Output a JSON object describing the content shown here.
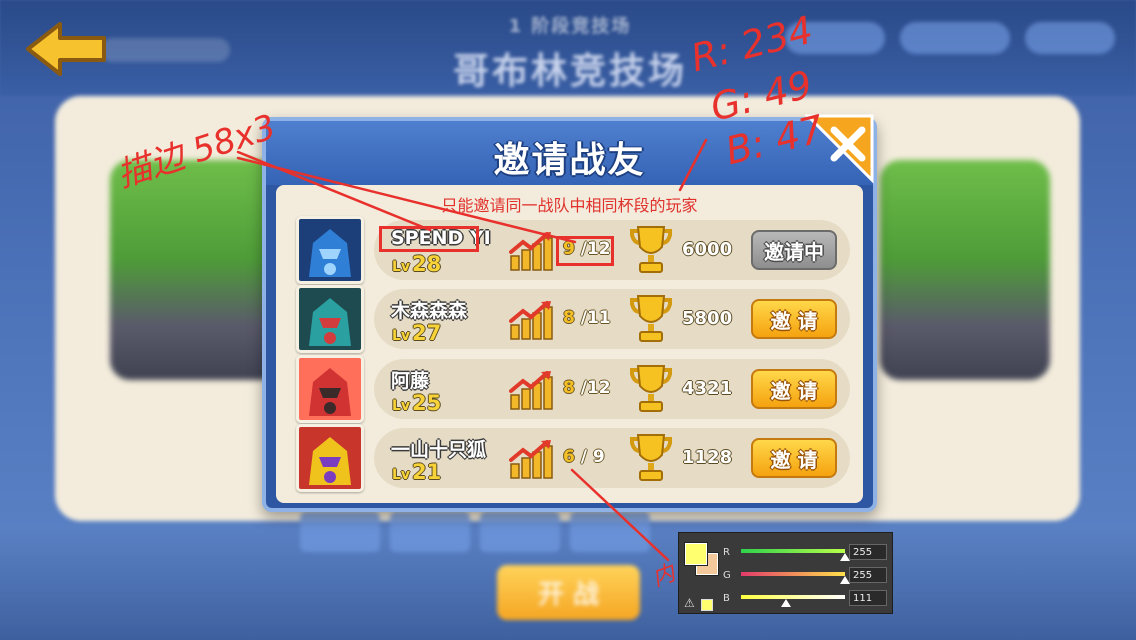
{
  "background": {
    "subtitle": "1 阶段竞技场",
    "title": "哥布林竞技场",
    "fight_button_label": "开 战"
  },
  "dialog": {
    "title": "邀请战友",
    "note": "只能邀请同一战队中相同杯段的玩家",
    "close_icon": "close-icon",
    "colors": {
      "note": "#e0312d",
      "button": "#f5a20f",
      "button_pending": "#8e8e8e",
      "level": "#f7d338"
    }
  },
  "players": [
    {
      "name": "SPEND YI",
      "lv_label": "Lv",
      "level": "28",
      "progress_current": "9",
      "progress_total": "/12",
      "trophies": "6000",
      "button": "邀请中",
      "button_state": "pending",
      "avatar": "blue-robot-avatar"
    },
    {
      "name": "木森森森",
      "lv_label": "Lv",
      "level": "27",
      "progress_current": "8",
      "progress_total": "/11",
      "trophies": "5800",
      "button": "邀 请",
      "button_state": "active",
      "avatar": "teal-robot-avatar"
    },
    {
      "name": "阿藤",
      "lv_label": "Lv",
      "level": "25",
      "progress_current": "8",
      "progress_total": "/12",
      "trophies": "4321",
      "button": "邀 请",
      "button_state": "active",
      "avatar": "red-robot-avatar"
    },
    {
      "name": "一山十只狐",
      "lv_label": "Lv",
      "level": "21",
      "progress_current": "6",
      "progress_total": "/ 9",
      "trophies": "1128",
      "button": "邀 请",
      "button_state": "active",
      "avatar": "gold-robot-avatar"
    }
  ],
  "annotations": {
    "size_note": "描边 58x3",
    "inner_note": "内",
    "r_note": "R: 234",
    "g_note": "G: 49",
    "b_note": "B: 47",
    "highlight_color": "#e8312c"
  },
  "color_picker": {
    "channels": [
      {
        "label": "R",
        "value": "255",
        "level": 1.0
      },
      {
        "label": "G",
        "value": "255",
        "level": 1.0
      },
      {
        "label": "B",
        "value": "111",
        "level": 0.435
      }
    ],
    "foreground": "#ffff6f",
    "background": "#f3c99c"
  }
}
